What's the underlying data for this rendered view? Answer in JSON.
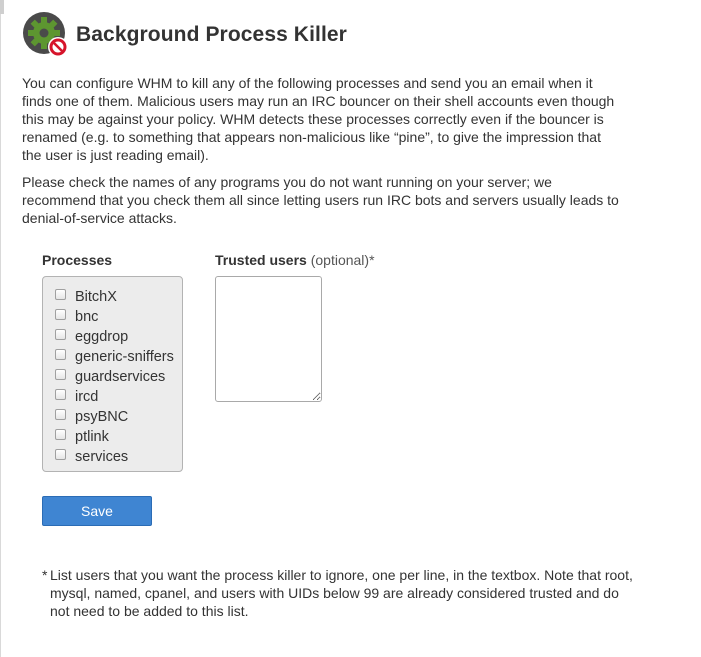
{
  "page": {
    "title": "Background Process Killer",
    "intro": "You can configure WHM to kill any of the following processes and send you an email when it finds one of them. Malicious users may run an IRC bouncer on their shell accounts even though this may be against your policy. WHM detects these processes correctly even if the bouncer is renamed (e.g. to something that appears non-malicious like “pine”, to give the impression that the user is just reading email).",
    "instructions": "Please check the names of any programs you do not want running on your server; we recommend that you check them all since letting users run IRC bots and servers usually leads to denial-of-service attacks."
  },
  "processes": {
    "label": "Processes",
    "items": [
      {
        "label": "BitchX",
        "checked": false
      },
      {
        "label": "bnc",
        "checked": false
      },
      {
        "label": "eggdrop",
        "checked": false
      },
      {
        "label": "generic-sniffers",
        "checked": false
      },
      {
        "label": "guardservices",
        "checked": false
      },
      {
        "label": "ircd",
        "checked": false
      },
      {
        "label": "psyBNC",
        "checked": false
      },
      {
        "label": "ptlink",
        "checked": false
      },
      {
        "label": "services",
        "checked": false
      }
    ]
  },
  "trusted": {
    "label": "Trusted users",
    "optional": "(optional)*",
    "value": ""
  },
  "actions": {
    "save_label": "Save"
  },
  "footnote": {
    "marker": "*",
    "text": "List users that you want the process killer to ignore, one per line, in the textbox. Note that root, mysql, named, cpanel, and users with UIDs below 99 are already considered trusted and do not need to be added to this list."
  },
  "colors": {
    "primary_button": "#3f85d2",
    "logo_gear": "#5d9630",
    "logo_ring": "#4a4a4a",
    "stop_badge": "#d6142b"
  },
  "icons": {
    "logo": "gear-with-stop-sign-icon"
  }
}
